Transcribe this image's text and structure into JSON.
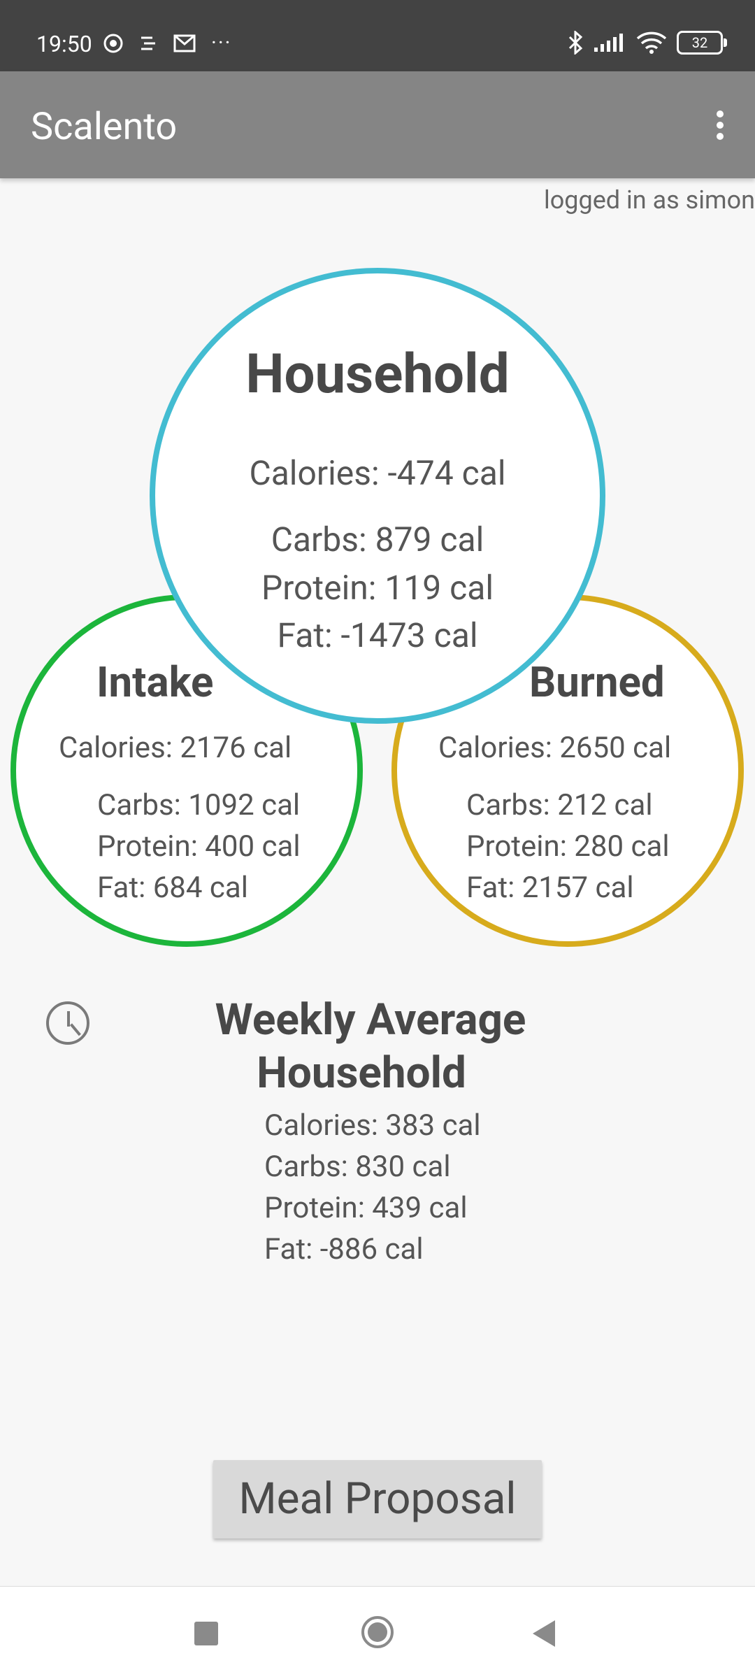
{
  "status_bar": {
    "time": "19:50",
    "more": "···",
    "battery": "32",
    "icons": [
      "chrome-icon",
      "keyboard-icon",
      "mail-icon",
      "bluetooth-icon",
      "signal-icon",
      "wifi-icon"
    ]
  },
  "app_bar": {
    "title": "Scalento",
    "overflow_icon": "more-vert-icon"
  },
  "logged_in": "logged in as simon",
  "household": {
    "title": "Household",
    "calories": "Calories: -474 cal",
    "carbs": "Carbs: 879 cal",
    "protein": "Protein: 119 cal",
    "fat": "Fat: -1473 cal",
    "ring_color": "#43bcd1"
  },
  "intake": {
    "title": "Intake",
    "calories": "Calories: 2176 cal",
    "carbs": "Carbs: 1092 cal",
    "protein": "Protein: 400 cal",
    "fat": "Fat: 684 cal",
    "ring_color": "#1cb53b"
  },
  "burned": {
    "title": "Burned",
    "calories": "Calories: 2650 cal",
    "carbs": "Carbs: 212 cal",
    "protein": "Protein: 280 cal",
    "fat": "Fat: 2157 cal",
    "ring_color": "#d7ab1c"
  },
  "weekly": {
    "title_line1": "Weekly Average",
    "title_line2": "Household",
    "calories": "Calories: 383 cal",
    "carbs": "Carbs: 830 cal",
    "protein": "Protein: 439 cal",
    "fat": "Fat: -886 cal"
  },
  "meal_button": "Meal Proposal",
  "nav": [
    "recents-icon",
    "home-icon",
    "back-icon"
  ]
}
